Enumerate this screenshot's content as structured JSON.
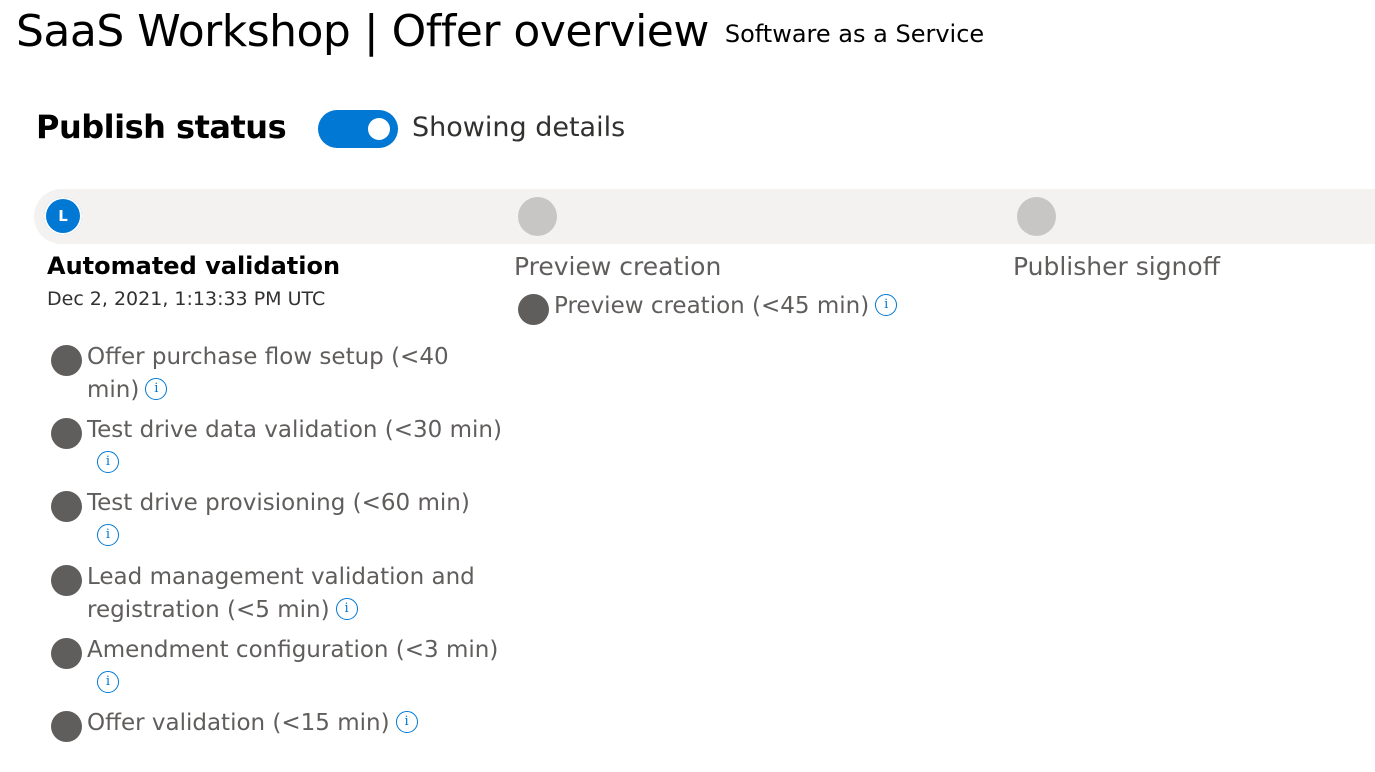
{
  "header": {
    "title": "SaaS Workshop | Offer overview",
    "subtitle": "Software as a Service"
  },
  "publish_status": {
    "heading": "Publish status",
    "toggle_label": "Showing details",
    "toggle_on": true
  },
  "colors": {
    "accent": "#0078d4",
    "pending": "#c8c6c4",
    "task_bullet": "#605e5c",
    "track": "#f3f2f1"
  },
  "steps": [
    {
      "initial": "L",
      "title": "Automated validation",
      "date": "Dec 2, 2021, 1:13:33 PM UTC",
      "tasks": [
        {
          "text": "Offer purchase flow setup (<40 min)",
          "info_icon": "info-icon"
        },
        {
          "text": "Test drive data validation (<30 min)",
          "info_icon": "info-icon"
        },
        {
          "text": "Test drive provisioning (<60 min)",
          "info_icon": "info-icon"
        },
        {
          "text": "Lead management validation and registration (<5 min)",
          "info_icon": "info-icon"
        },
        {
          "text": "Amendment configuration (<3 min)",
          "info_icon": "info-icon"
        },
        {
          "text": "Offer validation (<15 min)",
          "info_icon": "info-icon"
        }
      ]
    },
    {
      "title": "Preview creation",
      "tasks": [
        {
          "text": "Preview creation (<45 min)",
          "info_icon": "info-icon"
        }
      ]
    },
    {
      "title": "Publisher signoff",
      "tasks": []
    }
  ],
  "info_glyph": "i"
}
